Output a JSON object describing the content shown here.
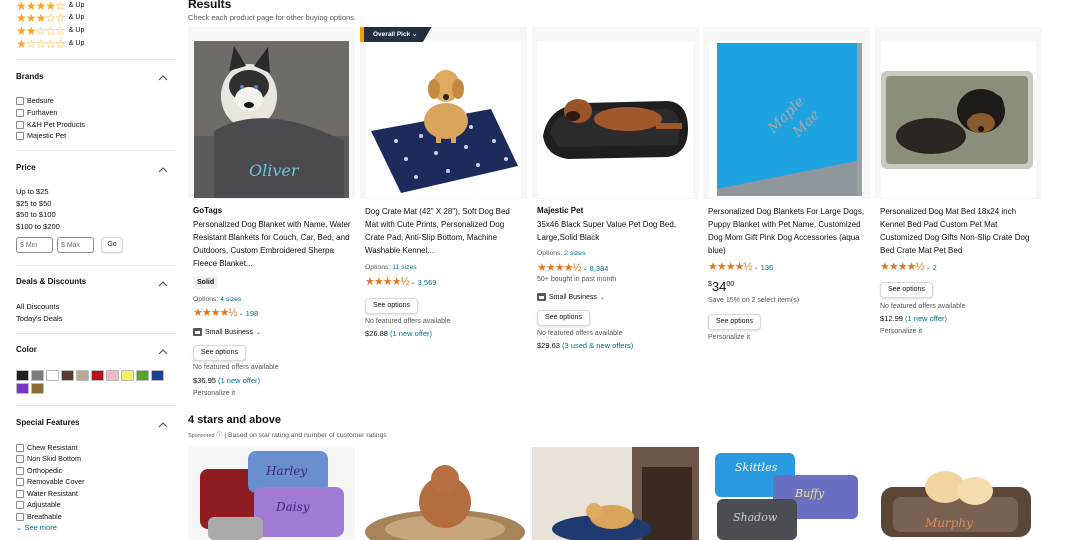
{
  "sidebar": {
    "ratings": [
      {
        "stars": "★★★★☆",
        "label": "& Up"
      },
      {
        "stars": "★★★☆☆",
        "label": "& Up"
      },
      {
        "stars": "★★☆☆☆",
        "label": "& Up"
      },
      {
        "stars": "★☆☆☆☆",
        "label": "& Up"
      }
    ],
    "brands": {
      "title": "Brands",
      "items": [
        "Bedsure",
        "Furhaven",
        "K&H Pet Products",
        "Majestic Pet"
      ]
    },
    "price": {
      "title": "Price",
      "ranges": [
        "Up to $25",
        "$25 to $50",
        "$50 to $100",
        "$100 to $200"
      ],
      "min_placeholder": "$ Min",
      "max_placeholder": "$ Max",
      "go": "Go"
    },
    "deals": {
      "title": "Deals & Discounts",
      "items": [
        "All Discounts",
        "Today's Deals"
      ]
    },
    "color": {
      "title": "Color",
      "swatches": [
        "#222222",
        "#7a7a7a",
        "#ffffff",
        "#5b3b2c",
        "#b8a98a",
        "#b3121b",
        "#f3b9c6",
        "#f2f06a",
        "#4da628",
        "#1f3f8f",
        "#7b33c6",
        "#8b6a3e"
      ]
    },
    "features": {
      "title": "Special Features",
      "items": [
        "Chew Resistant",
        "Non Skid Bottom",
        "Orthopedic",
        "Removable Cover",
        "Water Resistant",
        "Adjustable",
        "Breathable"
      ],
      "see_more": "See more"
    }
  },
  "results": {
    "title": "Results",
    "subtitle": "Check each product page for other buying options."
  },
  "products": [
    {
      "brand": "GoTags",
      "title": "Personalized Dog Blanket with Name, Water Resistant Blankets for Couch, Car, Bed, and Outdoors, Custom Embroidered Sherpa Fleece Blanket...",
      "chip": "Solid",
      "options_label": "Options:",
      "options_link": "4 sizes",
      "stars": "★★★★½",
      "reviews": "198",
      "small_business": "Small Business",
      "button": "See options",
      "no_offers": "No featured offers available",
      "price": "$36.95",
      "offer": "(1 new offer)",
      "personalize": "Personalize it"
    },
    {
      "badge": "Overall Pick",
      "title": "Dog Crate Mat (42\" X 28\"), Soft Dog Bed Mat with Cute Prints, Personalized Dog Crate Pad, Anti-Slip Bottom, Machine Washable Kennel...",
      "options_label": "Options:",
      "options_link": "11 sizes",
      "stars": "★★★★½",
      "reviews": "3,569",
      "button": "See options",
      "no_offers": "No featured offers available",
      "price": "$26.88",
      "offer": "(1 new offer)"
    },
    {
      "brand": "Majestic Pet",
      "title": "35x46 Black Super Value Pet Dog Bed, Large,Solid Black",
      "options_label": "Options:",
      "options_link": "2 sizes",
      "stars": "★★★★½",
      "reviews": "8,384",
      "bought": "50+ bought in past month",
      "small_business": "Small Business",
      "button": "See options",
      "no_offers": "No featured offers available",
      "price": "$29.63",
      "offer": "(3 used & new offers)"
    },
    {
      "title": "Personalized Dog Blankets For Large Dogs, Puppy Blanket with Pet Name, Customized Dog Mom Gift Pink Dog Accessories (aqua blue)",
      "stars": "★★★★½",
      "reviews": "136",
      "price_currency": "$",
      "price_whole": "34",
      "price_cents": "00",
      "save": "Save 15% on 2 select item(s)",
      "button": "See options",
      "personalize": "Personalize it"
    },
    {
      "title": "Personalized Dog Mat Bed 18x24 inch Kennel Bed Pad Custom Pet Mat Customized Dog Gifts Non-Slip Crate Dog Bed Crate Mat Pet Bed",
      "stars": "★★★★½",
      "reviews": "2",
      "button": "See options",
      "no_offers": "No featured offers available",
      "price": "$12.99",
      "offer": "(1 new offer)",
      "personalize": "Personalize it"
    }
  ],
  "section2": {
    "title": "4 stars and above",
    "sponsored": "Sponsored",
    "subtitle": "| Based on star rating and number of customer ratings"
  },
  "colors": {
    "accent_link": "#007185",
    "star": "#de7921",
    "badge_bg": "#232f3e"
  }
}
